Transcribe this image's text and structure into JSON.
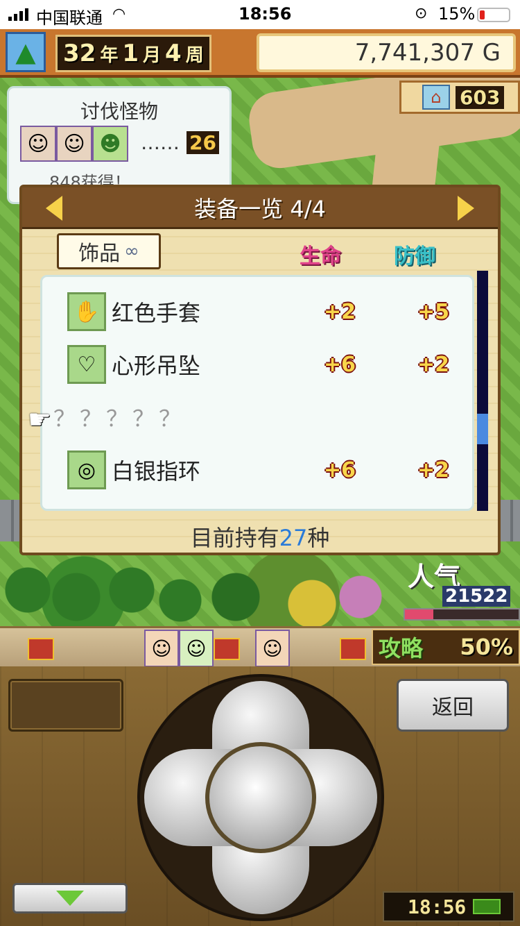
{
  "status_bar": {
    "carrier": "中国联通",
    "time": "18:56",
    "battery": "15%"
  },
  "hud": {
    "year": "32",
    "year_unit": "年",
    "month": "1",
    "month_unit": "月",
    "week": "4",
    "week_unit": "周",
    "money": "7,741,307 G",
    "town_count": "603"
  },
  "hunt": {
    "title": "讨伐怪物",
    "dots": "……",
    "count": "26",
    "reward_text": "848获得！"
  },
  "dialog": {
    "title": "装备一览 4/4",
    "category": "饰品",
    "col_hp": "生命",
    "col_def": "防御",
    "items": [
      {
        "name": "红色手套",
        "hp": "+2",
        "def": "+5",
        "icon": "glove-icon"
      },
      {
        "name": "心形吊坠",
        "hp": "+6",
        "def": "+2",
        "icon": "pendant-icon"
      },
      {
        "name": "？？？？？",
        "hp": "",
        "def": "",
        "icon": ""
      },
      {
        "name": "白银指环",
        "hp": "+6",
        "def": "+2",
        "icon": "ring-icon"
      }
    ],
    "owned_prefix": "目前持有",
    "owned_count": "27",
    "owned_suffix": "种"
  },
  "popularity": {
    "label": "人气",
    "value": "21522",
    "bar_fraction": 0.25
  },
  "guide": {
    "label": "攻略",
    "percent": "50%"
  },
  "controls": {
    "back_label": "返回",
    "clock": "18:56"
  }
}
